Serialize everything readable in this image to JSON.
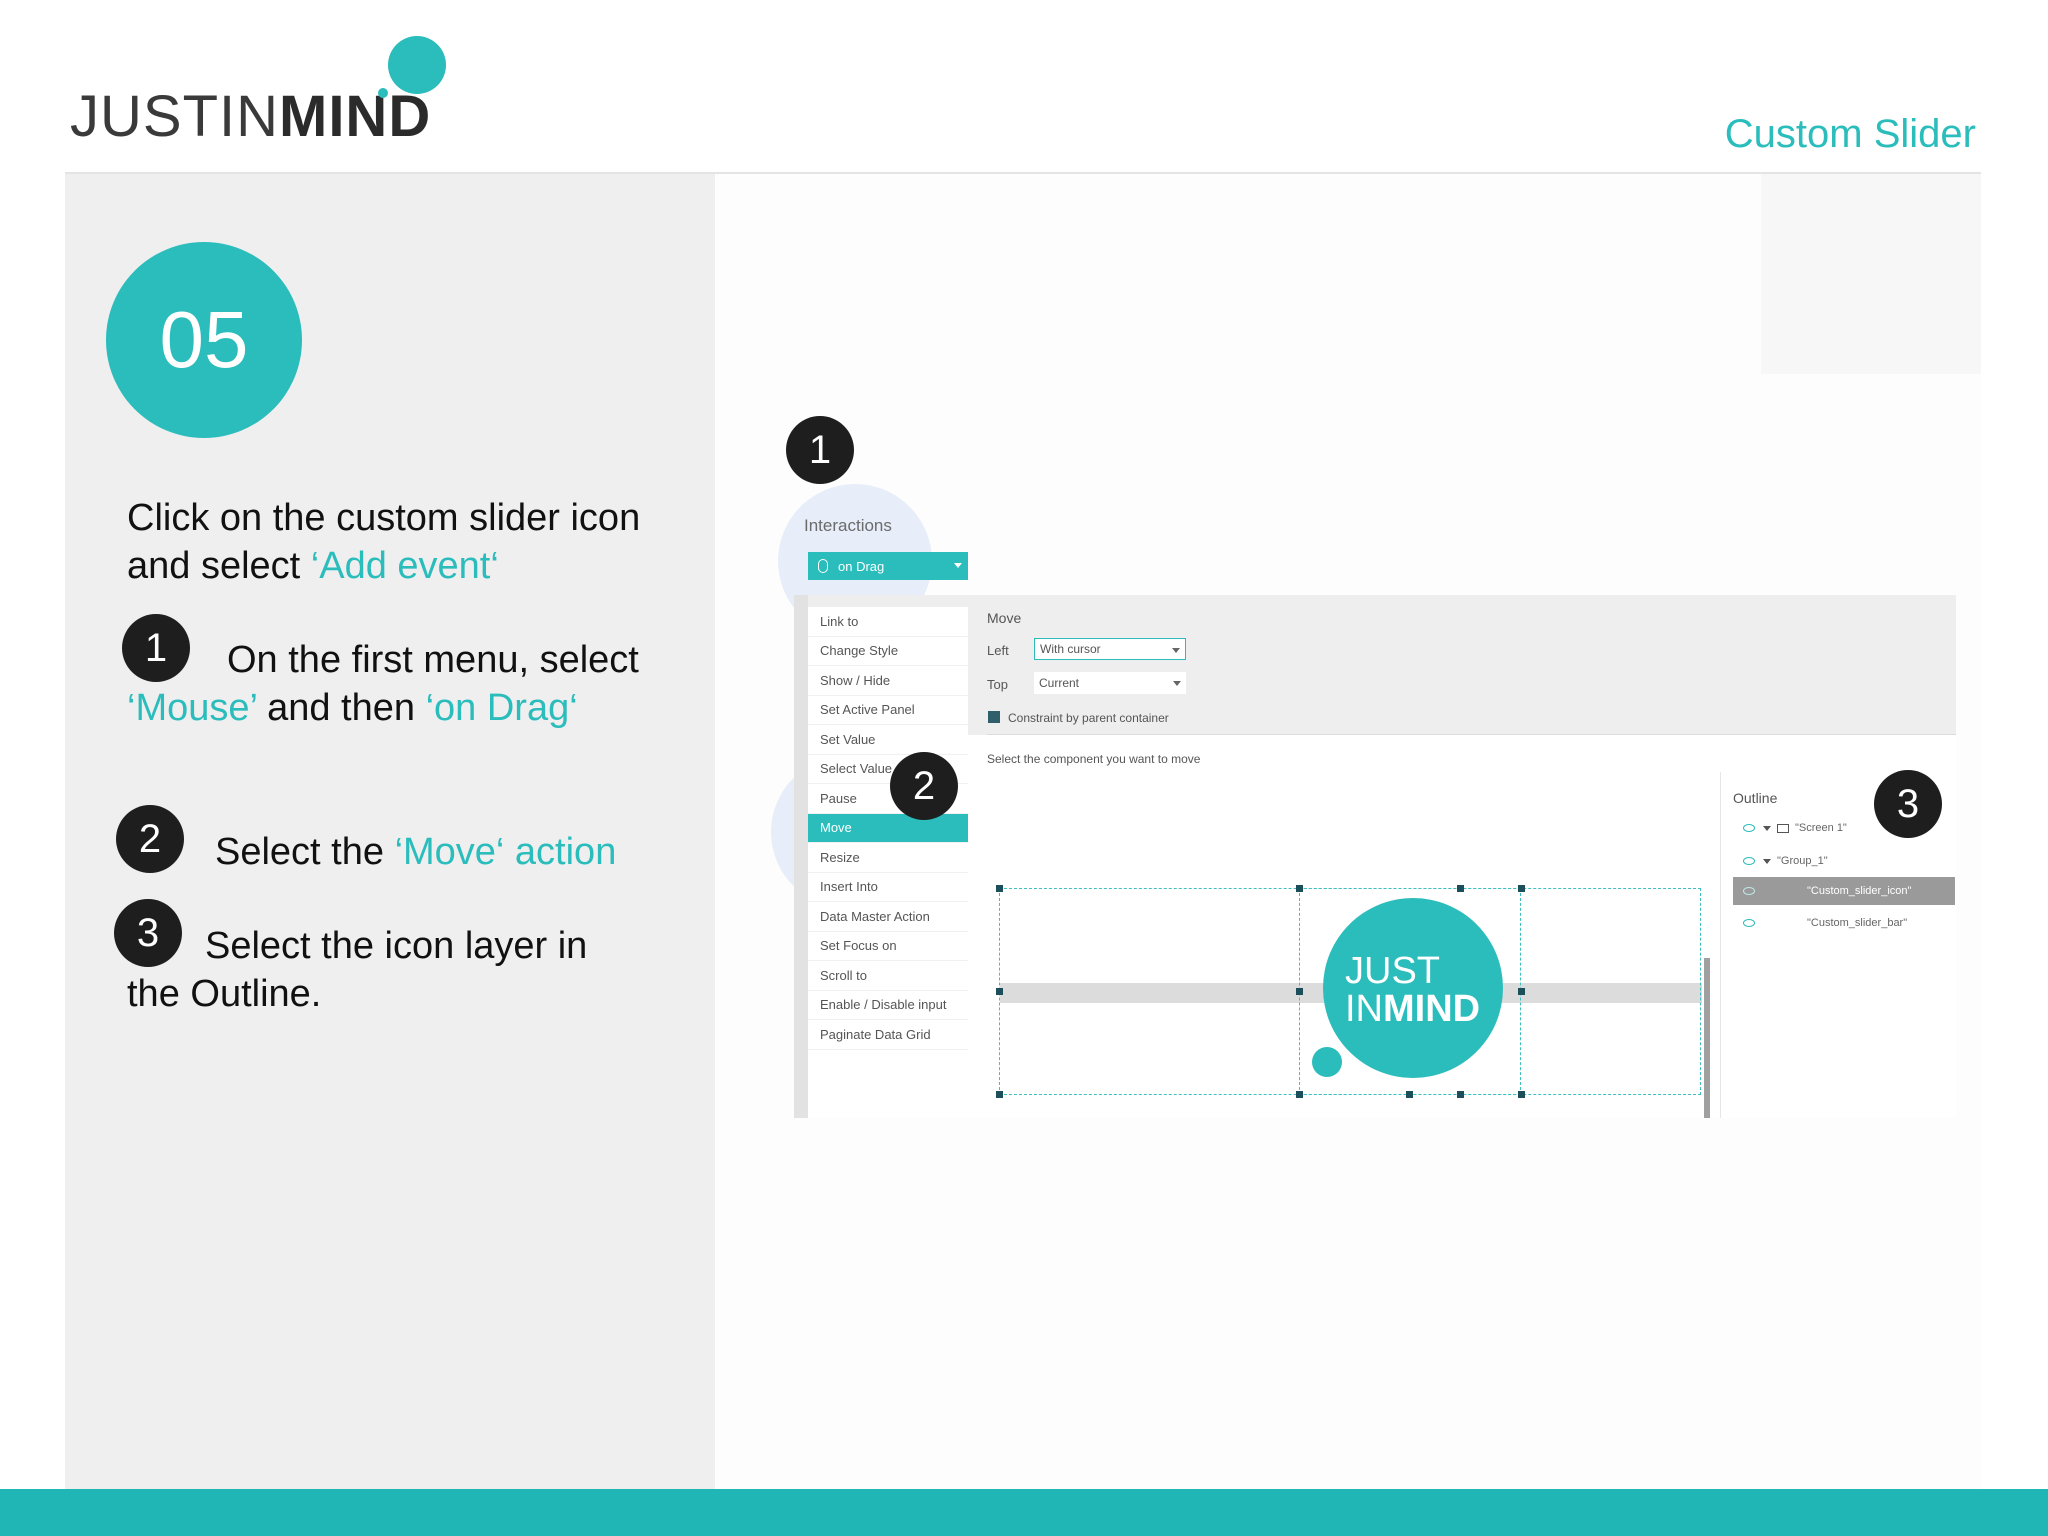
{
  "header": {
    "logo_light": "JUSTIN",
    "logo_bold": "MIND",
    "title": "Custom Slider"
  },
  "step": {
    "number": "05",
    "intro": {
      "text": "Click on the custom slider icon and select ",
      "highlight": "‘Add event‘"
    },
    "items": [
      {
        "num": "1",
        "pre": "On the first menu, select ",
        "hl1": "‘Mouse’",
        "mid": " and then ",
        "hl2": "‘on Drag‘"
      },
      {
        "num": "2",
        "pre": "Select the ",
        "hl": "‘Move‘ action"
      },
      {
        "num": "3",
        "text": "Select the icon layer in the Outline."
      }
    ]
  },
  "screenshot": {
    "callouts": [
      "1",
      "2",
      "3"
    ],
    "interactions_label": "Interactions",
    "event_dropdown": "on Drag",
    "actions": [
      "Link to",
      "Change Style",
      "Show / Hide",
      "Set Active Panel",
      "Set Value",
      "Select Value",
      "Pause",
      "Move",
      "Resize",
      "Insert Into",
      "Data Master Action",
      "Set Focus on",
      "Scroll to",
      "Enable / Disable input",
      "Paginate Data Grid"
    ],
    "selected_action": "Move",
    "move": {
      "title": "Move",
      "left_label": "Left",
      "left_value": "With cursor",
      "top_label": "Top",
      "top_value": "Current",
      "constraint_label": "Constraint by parent container",
      "constraint_checked": true,
      "select_component_label": "Select the component you want to move"
    },
    "canvas_logo": {
      "light": "JUST",
      "line2_light": "IN",
      "line2_bold": "MIND"
    },
    "outline": {
      "title": "Outline",
      "items": [
        "\"Screen 1\"",
        "\"Group_1\"",
        "\"Custom_slider_icon\"",
        "\"Custom_slider_bar\""
      ],
      "selected_index": 2
    }
  },
  "colors": {
    "accent": "#2bbcbc",
    "footer": "#21b6b6",
    "left_panel": "#efefef",
    "callout": "#1e1e1e"
  }
}
